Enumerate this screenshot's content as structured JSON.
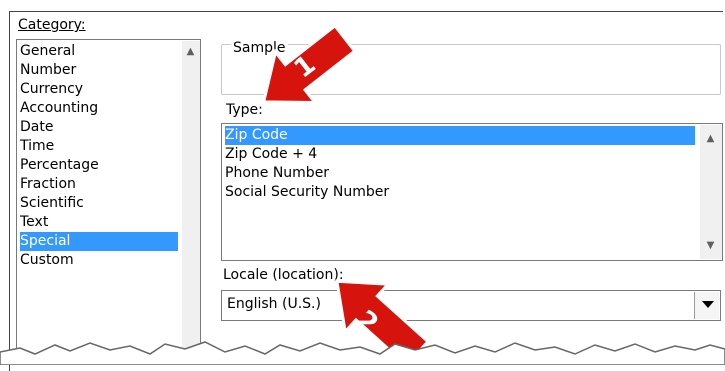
{
  "category": {
    "label": "Category:",
    "items": [
      "General",
      "Number",
      "Currency",
      "Accounting",
      "Date",
      "Time",
      "Percentage",
      "Fraction",
      "Scientific",
      "Text",
      "Special",
      "Custom"
    ],
    "selected": "Special"
  },
  "sample": {
    "label": "Sample",
    "value": ""
  },
  "type": {
    "label": "Type:",
    "items": [
      "Zip Code",
      "Zip Code + 4",
      "Phone Number",
      "Social Security Number"
    ],
    "selected": "Zip Code"
  },
  "locale": {
    "label": "Locale (location):",
    "value": "English (U.S.)"
  },
  "callouts": {
    "one": "1",
    "two": "2",
    "color": "#d6130c"
  },
  "colors": {
    "selection": "#3399ff"
  }
}
